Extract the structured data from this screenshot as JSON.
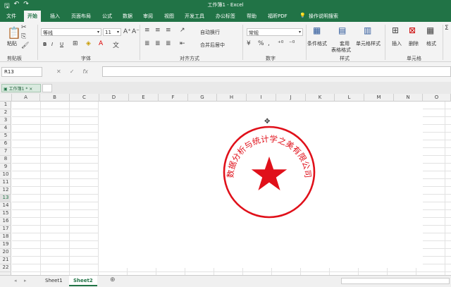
{
  "titlebar": {
    "title": "工作簿1 - Excel"
  },
  "tabs": [
    "文件",
    "开始",
    "插入",
    "页面布局",
    "公式",
    "数据",
    "审阅",
    "视图",
    "开发工具",
    "办公标签",
    "帮助",
    "福昕PDF",
    "操作说明搜索"
  ],
  "ribbon": {
    "clipboard": {
      "paste": "粘贴",
      "group": "剪贴板"
    },
    "font": {
      "name": "等线",
      "size": "11",
      "group": "字体",
      "bold": "B",
      "italic": "I",
      "underline": "U"
    },
    "align": {
      "wrap": "自动换行",
      "merge": "合并后居中",
      "group": "对齐方式"
    },
    "number": {
      "format": "常规",
      "group": "数字"
    },
    "styles": {
      "cond": "条件格式",
      "table": "套用",
      "table2": "表格格式",
      "cell": "单元格样式",
      "group": "样式"
    },
    "cells": {
      "insert": "插入",
      "delete": "删除",
      "format": "格式",
      "group": "单元格"
    }
  },
  "formula_bar": {
    "name_box": "R13",
    "fx": "fx"
  },
  "workbook_tab": {
    "label": "工作簿1 *",
    "close": "×"
  },
  "columns": [
    "A",
    "B",
    "C",
    "D",
    "E",
    "F",
    "G",
    "H",
    "I",
    "J",
    "K",
    "L",
    "M",
    "N",
    "O"
  ],
  "rows": [
    "1",
    "2",
    "3",
    "4",
    "5",
    "6",
    "7",
    "8",
    "9",
    "10",
    "11",
    "12",
    "13",
    "14",
    "15",
    "16",
    "17",
    "18",
    "19",
    "20",
    "21",
    "22"
  ],
  "selected_row": "13",
  "seal": {
    "text": "数据分析与统计学之美有限公司",
    "color": "#e0101a"
  },
  "sheets": [
    "Sheet1",
    "Sheet2"
  ],
  "active_sheet": "Sheet2",
  "add_sheet": "⊕"
}
